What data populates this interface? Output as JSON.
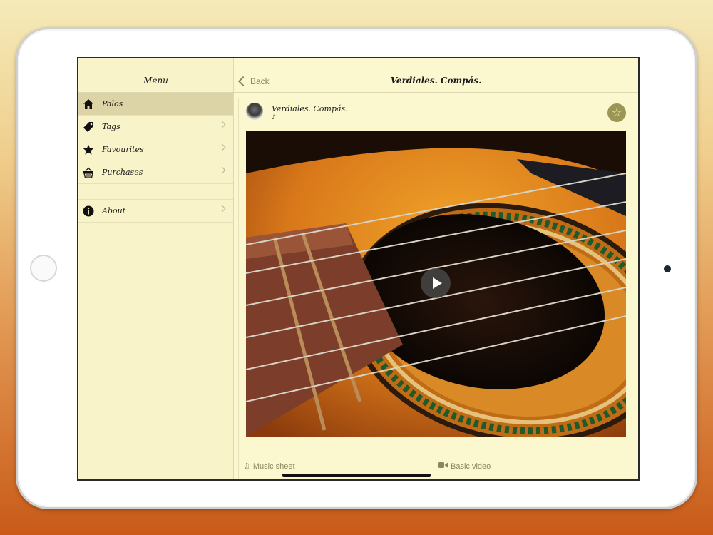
{
  "status_bar": {
    "left": "",
    "right": ""
  },
  "sidebar": {
    "title": "Menu",
    "items": [
      {
        "label": "Palos",
        "icon": "home-icon",
        "active": true
      },
      {
        "label": "Tags",
        "icon": "tag-icon"
      },
      {
        "label": "Favourites",
        "icon": "star-icon"
      },
      {
        "label": "Purchases",
        "icon": "basket-icon"
      },
      {
        "label": "About",
        "icon": "info-icon"
      }
    ]
  },
  "nav": {
    "back_label": "Back",
    "title": "Verdiales. Compás."
  },
  "post": {
    "title": "Verdiales. Compás.",
    "note": "♪",
    "favourite_icon": "☆",
    "media_description": "classical-guitar-soundhole-photo",
    "play_icon": "play-icon"
  },
  "footer": {
    "music_sheet_label": "Music sheet",
    "music_sheet_icon": "♫",
    "basic_video_label": "Basic video",
    "basic_video_icon": "video-camera-icon"
  },
  "colors": {
    "accent": "#8a875e",
    "background": "#fbf7cf",
    "active_row": "#dcd4a7",
    "favourite_button": "#9b9654"
  }
}
